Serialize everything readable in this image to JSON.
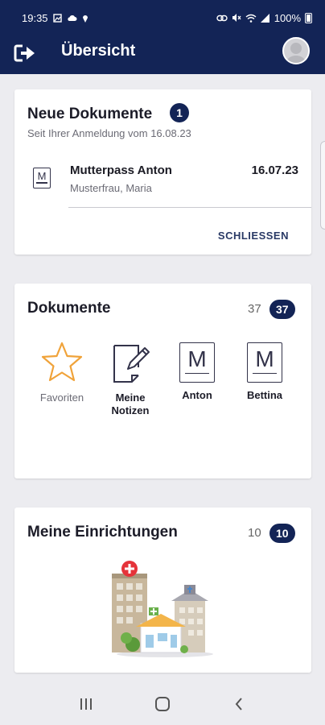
{
  "status_bar": {
    "time": "19:35",
    "left_icons": [
      "gallery-icon",
      "cloud-icon",
      "location-icon"
    ],
    "right_icons": [
      "link-icon",
      "mute-icon",
      "wifi-icon",
      "signal-icon"
    ],
    "battery": "100%"
  },
  "header": {
    "title": "Übersicht",
    "logout_icon": "logout-icon",
    "avatar_icon": "avatar-icon",
    "background": "#132456"
  },
  "new_documents": {
    "title": "Neue Dokumente",
    "badge": "1",
    "subtitle": "Seit Ihrer Anmeldung vom 16.08.23",
    "items": [
      {
        "icon": "document-m-icon",
        "title": "Mutterpass Anton",
        "subtitle": "Musterfrau, Maria",
        "date": "16.07.23"
      }
    ],
    "close_label": "SCHLIESSEN"
  },
  "documents": {
    "title": "Dokumente",
    "count": "37",
    "badge": "37",
    "folders": [
      {
        "label": "Favoriten",
        "icon": "star-icon"
      },
      {
        "label": "Meine\nNotizen",
        "icon": "notes-icon"
      },
      {
        "label": "Anton",
        "icon": "document-m-icon"
      },
      {
        "label": "Bettina",
        "icon": "document-m-icon"
      }
    ]
  },
  "facilities": {
    "title": "Meine Einrichtungen",
    "count": "10",
    "badge": "10",
    "illustration": "hospital-buildings-illustration"
  },
  "colors": {
    "accent": "#132456",
    "star": "#f0a33a",
    "background": "#ececf0"
  }
}
